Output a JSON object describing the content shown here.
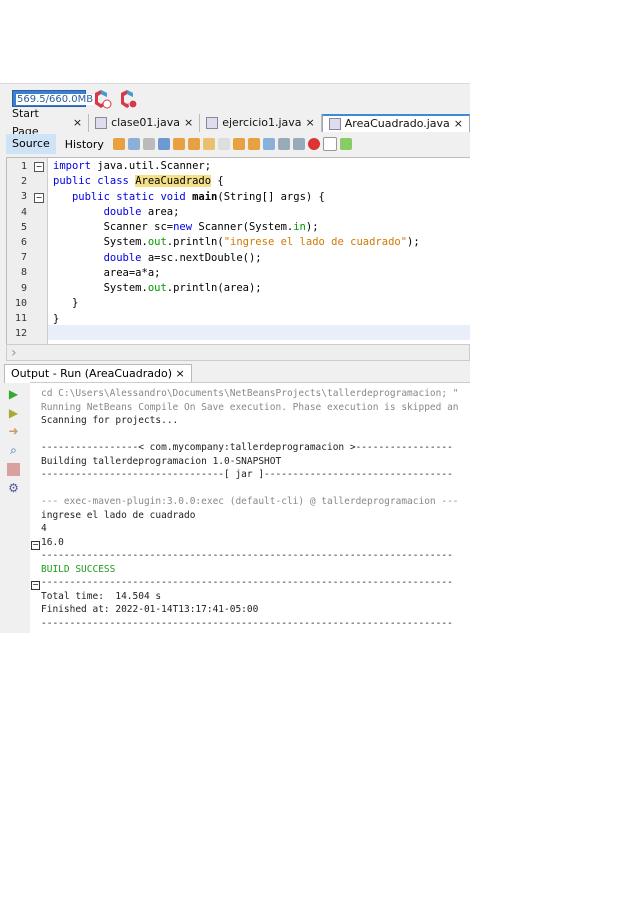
{
  "memory": "569.5/660.0MB",
  "tabs": [
    {
      "label": "Start Page"
    },
    {
      "label": "clase01.java"
    },
    {
      "label": "ejercicio1.java"
    },
    {
      "label": "AreaCuadrado.java"
    }
  ],
  "close": "×",
  "toolbar": {
    "source": "Source",
    "history": "History"
  },
  "editor": {
    "line_numbers": [
      "1",
      "2",
      "3",
      "4",
      "5",
      "6",
      "7",
      "8",
      "9",
      "10",
      "11",
      "12"
    ]
  },
  "output": {
    "tab": "Output - Run (AreaCuadrado)",
    "lines": [
      "cd C:\\Users\\Alessandro\\Documents\\NetBeansProjects\\tallerdeprogramacion; \"",
      "Running NetBeans Compile On Save execution. Phase execution is skipped an",
      "Scanning for projects...",
      "",
      "-----------------< com.mycompany:tallerdeprogramacion >-----------------",
      "Building tallerdeprogramacion 1.0-SNAPSHOT",
      "--------------------------------[ jar ]---------------------------------",
      "",
      "--- exec-maven-plugin:3.0.0:exec (default-cli) @ tallerdeprogramacion ---",
      "ingrese el lado de cuadrado",
      "4",
      "16.0",
      "------------------------------------------------------------------------",
      "BUILD SUCCESS",
      "------------------------------------------------------------------------",
      "Total time:  14.504 s",
      "Finished at: 2022-01-14T13:17:41-05:00",
      "------------------------------------------------------------------------"
    ]
  }
}
